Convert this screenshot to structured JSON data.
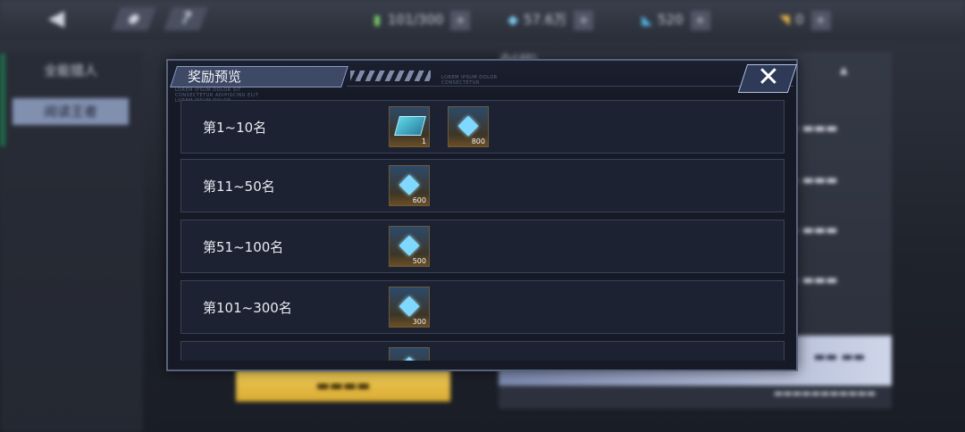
{
  "background": {
    "stamina": "101/300",
    "diamonds": "57.6万",
    "crystals": "520",
    "tickets": "0",
    "tabs": [
      "全能猎人",
      "阅读王者"
    ],
    "title": "剑指"
  },
  "modal": {
    "title": "奖励预览",
    "tiny_text_left": "LOREM IPSUM DOLOR SIT CONSECTETUR ADIPISCING ELIT LOREM IPSUM DOLOR",
    "tiny_text_right": "LOREM IPSUM DOLOR CONSECTETUR",
    "rows": [
      {
        "label": "第1~10名",
        "rewards": [
          {
            "icon": "card-icon",
            "qty": "1"
          },
          {
            "icon": "diamond-icon",
            "qty": "800"
          }
        ]
      },
      {
        "label": "第11~50名",
        "rewards": [
          {
            "icon": "diamond-icon",
            "qty": "600"
          }
        ]
      },
      {
        "label": "第51~100名",
        "rewards": [
          {
            "icon": "diamond-icon",
            "qty": "500"
          }
        ]
      },
      {
        "label": "第101~300名",
        "rewards": [
          {
            "icon": "diamond-icon",
            "qty": "300"
          }
        ]
      },
      {
        "label": "",
        "rewards": [
          {
            "icon": "diamond-icon",
            "qty": ""
          }
        ]
      }
    ]
  },
  "colors": {
    "modal_bg": "#161a26",
    "modal_border": "#58627c",
    "diamond": "#7fd8ff",
    "yellow_button": "#f1cf5a"
  }
}
